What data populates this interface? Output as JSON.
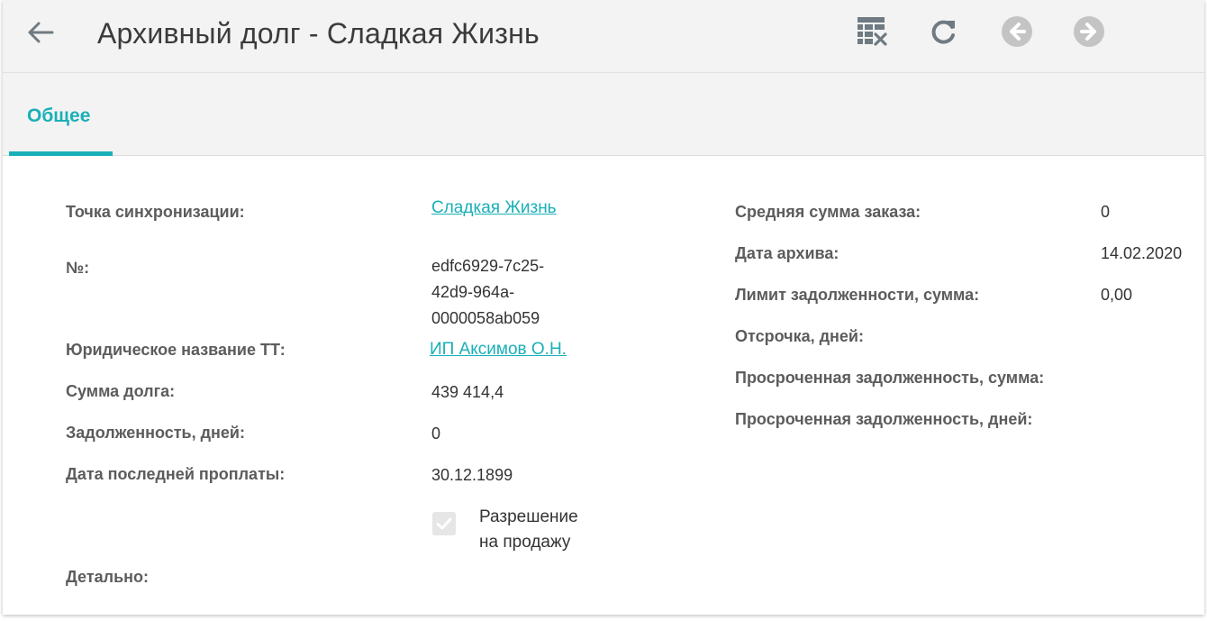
{
  "header": {
    "title": "Архивный долг - Сладкая Жизнь",
    "icons": [
      "back-arrow-icon",
      "table-clear-icon",
      "refresh-icon",
      "previous-record-icon",
      "next-record-icon"
    ]
  },
  "tabs": [
    {
      "label": "Общее",
      "active": true
    }
  ],
  "colors": {
    "accent": "#1ab0b8",
    "header_bg": "#f3f3f3",
    "label": "#5c5c5c",
    "icon": "#6f7a82",
    "icon_disabled": "#c4c4c4"
  },
  "left": {
    "sync_point": {
      "label": "Точка синхронизации:",
      "value": "Сладкая Жизнь"
    },
    "number": {
      "label": "№:",
      "value_lines": [
        "edfc6929-7c25-",
        "42d9-964a-",
        "0000058ab059"
      ]
    },
    "legal_name": {
      "label": "Юридическое название ТТ:",
      "value": "ИП Аксимов О.Н."
    },
    "debt_sum": {
      "label": "Сумма долга:",
      "value": "439 414,4"
    },
    "debt_days": {
      "label": "Задолженность, дней:",
      "value": "0"
    },
    "last_payment": {
      "label": "Дата последней проплаты:",
      "value": "30.12.1899"
    },
    "sale_permission": {
      "label_lines": [
        "Разрешение",
        "на продажу"
      ],
      "checked": true
    },
    "details": {
      "label": "Детально:"
    }
  },
  "right": {
    "avg_order": {
      "label": "Средняя сумма заказа:",
      "value": "0"
    },
    "archive_date": {
      "label": "Дата архива:",
      "value": "14.02.2020"
    },
    "debt_limit": {
      "label": "Лимит задолженности, сумма:",
      "value": "0,00"
    },
    "deferral": {
      "label": "Отсрочка, дней:",
      "value": ""
    },
    "overdue_sum": {
      "label": "Просроченная задолженность, сумма:",
      "value": ""
    },
    "overdue_days": {
      "label": "Просроченная задолженность, дней:",
      "value": ""
    }
  }
}
